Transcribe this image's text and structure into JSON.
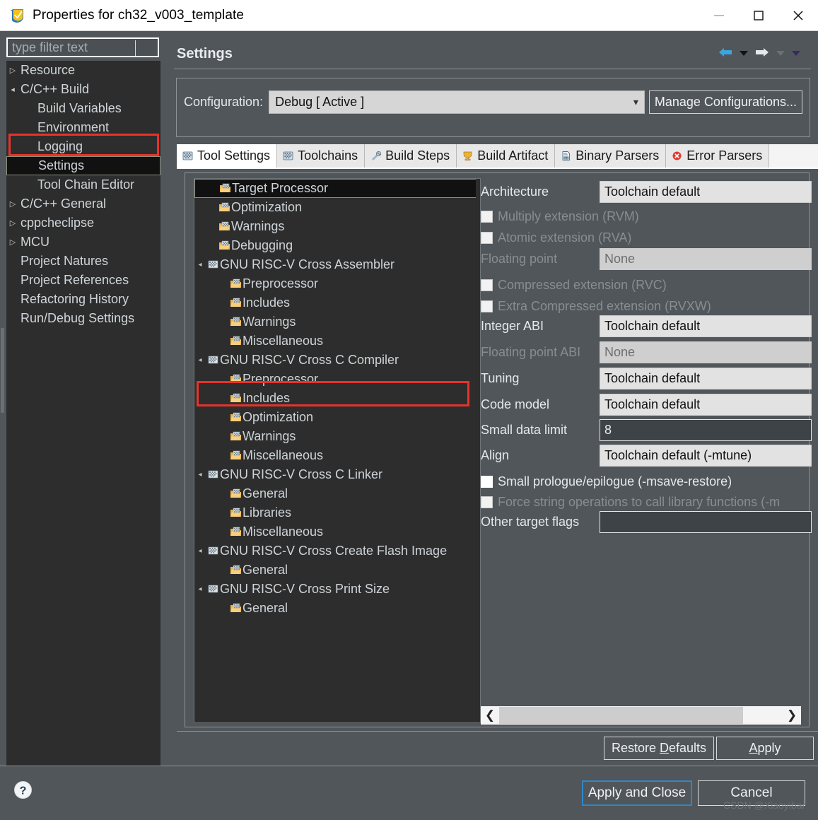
{
  "window": {
    "title": "Properties for ch32_v003_template",
    "app_icon": "eclipse-properties-icon",
    "minimize": "minimize-icon",
    "maximize": "maximize-icon",
    "close": "close-icon"
  },
  "filter": {
    "placeholder": "type filter text",
    "value": ""
  },
  "sidebar": {
    "items": [
      {
        "label": "Resource",
        "arrow": "▷",
        "indent": 0,
        "selected": false
      },
      {
        "label": "C/C++ Build",
        "arrow": "◂",
        "indent": 0,
        "selected": false
      },
      {
        "label": "Build Variables",
        "arrow": "",
        "indent": 1,
        "selected": false
      },
      {
        "label": "Environment",
        "arrow": "",
        "indent": 1,
        "selected": false
      },
      {
        "label": "Logging",
        "arrow": "",
        "indent": 1,
        "selected": false
      },
      {
        "label": "Settings",
        "arrow": "",
        "indent": 1,
        "selected": true
      },
      {
        "label": "Tool Chain Editor",
        "arrow": "",
        "indent": 1,
        "selected": false
      },
      {
        "label": "C/C++ General",
        "arrow": "▷",
        "indent": 0,
        "selected": false
      },
      {
        "label": "cppcheclipse",
        "arrow": "▷",
        "indent": 0,
        "selected": false
      },
      {
        "label": "MCU",
        "arrow": "▷",
        "indent": 0,
        "selected": false
      },
      {
        "label": "Project Natures",
        "arrow": "",
        "indent": 0,
        "selected": false
      },
      {
        "label": "Project References",
        "arrow": "",
        "indent": 0,
        "selected": false
      },
      {
        "label": "Refactoring History",
        "arrow": "",
        "indent": 0,
        "selected": false
      },
      {
        "label": "Run/Debug Settings",
        "arrow": "",
        "indent": 0,
        "selected": false
      }
    ]
  },
  "header": {
    "title": "Settings",
    "back_icon": "back-arrow-icon",
    "back_dropdown_icon": "chevron-down-icon",
    "forward_icon": "forward-arrow-icon",
    "forward_dropdown_icon": "chevron-down-icon",
    "menu_dropdown_icon": "chevron-down-icon"
  },
  "configuration": {
    "label": "Configuration:",
    "value": "Debug  [ Active ]",
    "dropdown_icon": "chevron-down-icon",
    "manage_button": "Manage Configurations..."
  },
  "tabs": [
    {
      "label": "Tool Settings",
      "icon": "tool-settings-icon",
      "active": true
    },
    {
      "label": "Toolchains",
      "icon": "toolchains-icon",
      "active": false
    },
    {
      "label": "Build Steps",
      "icon": "build-steps-icon",
      "active": false
    },
    {
      "label": "Build Artifact",
      "icon": "build-artifact-icon",
      "active": false
    },
    {
      "label": "Binary Parsers",
      "icon": "binary-parsers-icon",
      "active": false
    },
    {
      "label": "Error Parsers",
      "icon": "error-parsers-icon",
      "active": false
    }
  ],
  "tool_tree": [
    {
      "label": "Target Processor",
      "indent": 1,
      "arrow": "",
      "icon": "folder-icon",
      "selected": true
    },
    {
      "label": "Optimization",
      "indent": 1,
      "arrow": "",
      "icon": "folder-icon",
      "selected": false
    },
    {
      "label": "Warnings",
      "indent": 1,
      "arrow": "",
      "icon": "folder-icon",
      "selected": false
    },
    {
      "label": "Debugging",
      "indent": 1,
      "arrow": "",
      "icon": "folder-icon",
      "selected": false
    },
    {
      "label": "GNU RISC-V Cross Assembler",
      "indent": 0,
      "arrow": "◂",
      "icon": "tool-icon",
      "selected": false
    },
    {
      "label": "Preprocessor",
      "indent": 2,
      "arrow": "",
      "icon": "folder-icon",
      "selected": false
    },
    {
      "label": "Includes",
      "indent": 2,
      "arrow": "",
      "icon": "folder-icon",
      "selected": false
    },
    {
      "label": "Warnings",
      "indent": 2,
      "arrow": "",
      "icon": "folder-icon",
      "selected": false
    },
    {
      "label": "Miscellaneous",
      "indent": 2,
      "arrow": "",
      "icon": "folder-icon",
      "selected": false
    },
    {
      "label": "GNU RISC-V Cross C Compiler",
      "indent": 0,
      "arrow": "◂",
      "icon": "tool-icon",
      "selected": false
    },
    {
      "label": "Preprocessor",
      "indent": 2,
      "arrow": "",
      "icon": "folder-icon",
      "selected": false
    },
    {
      "label": "Includes",
      "indent": 2,
      "arrow": "",
      "icon": "folder-icon",
      "selected": false
    },
    {
      "label": "Optimization",
      "indent": 2,
      "arrow": "",
      "icon": "folder-icon",
      "selected": false
    },
    {
      "label": "Warnings",
      "indent": 2,
      "arrow": "",
      "icon": "folder-icon",
      "selected": false
    },
    {
      "label": "Miscellaneous",
      "indent": 2,
      "arrow": "",
      "icon": "folder-icon",
      "selected": false
    },
    {
      "label": "GNU RISC-V Cross C Linker",
      "indent": 0,
      "arrow": "◂",
      "icon": "tool-icon",
      "selected": false
    },
    {
      "label": "General",
      "indent": 2,
      "arrow": "",
      "icon": "folder-icon",
      "selected": false
    },
    {
      "label": "Libraries",
      "indent": 2,
      "arrow": "",
      "icon": "folder-icon",
      "selected": false
    },
    {
      "label": "Miscellaneous",
      "indent": 2,
      "arrow": "",
      "icon": "folder-icon",
      "selected": false
    },
    {
      "label": "GNU RISC-V Cross Create Flash Image",
      "indent": 0,
      "arrow": "◂",
      "icon": "tool-icon",
      "selected": false
    },
    {
      "label": "General",
      "indent": 2,
      "arrow": "",
      "icon": "folder-icon",
      "selected": false
    },
    {
      "label": "GNU RISC-V Cross Print Size",
      "indent": 0,
      "arrow": "◂",
      "icon": "tool-icon",
      "selected": false
    },
    {
      "label": "General",
      "indent": 2,
      "arrow": "",
      "icon": "folder-icon",
      "selected": false
    }
  ],
  "fields": [
    {
      "kind": "combo",
      "label": "Architecture",
      "value": "Toolchain default",
      "disabled": false
    },
    {
      "kind": "checkbox",
      "label": "Multiply extension (RVM)",
      "checked": false,
      "disabled": true
    },
    {
      "kind": "checkbox",
      "label": "Atomic extension (RVA)",
      "checked": false,
      "disabled": true
    },
    {
      "kind": "combo",
      "label": "Floating point",
      "value": "None",
      "disabled": true
    },
    {
      "kind": "checkbox",
      "label": "Compressed extension (RVC)",
      "checked": false,
      "disabled": true
    },
    {
      "kind": "checkbox",
      "label": "Extra Compressed extension (RVXW)",
      "checked": false,
      "disabled": true
    },
    {
      "kind": "combo",
      "label": "Integer ABI",
      "value": "Toolchain default",
      "disabled": false
    },
    {
      "kind": "combo",
      "label": "Floating point ABI",
      "value": "None",
      "disabled": true
    },
    {
      "kind": "combo",
      "label": "Tuning",
      "value": "Toolchain default",
      "disabled": false
    },
    {
      "kind": "combo",
      "label": "Code model",
      "value": "Toolchain default",
      "disabled": false
    },
    {
      "kind": "text",
      "label": "Small data limit",
      "value": "8",
      "disabled": false
    },
    {
      "kind": "combo",
      "label": "Align",
      "value": "Toolchain default (-mtune)",
      "disabled": false
    },
    {
      "kind": "checkbox",
      "label": "Small prologue/epilogue (-msave-restore)",
      "checked": false,
      "disabled": false
    },
    {
      "kind": "checkbox",
      "label": "Force string operations to call library functions (-m",
      "checked": false,
      "disabled": true
    },
    {
      "kind": "text",
      "label": "Other target flags",
      "value": "",
      "disabled": false
    }
  ],
  "hscroll": {
    "left_arrow": "chevron-left-icon",
    "right_arrow": "chevron-right-icon"
  },
  "buttons": {
    "restore_defaults": "Restore Defaults",
    "restore_defaults_mnemonic": "D",
    "apply": "Apply",
    "apply_mnemonic": "A",
    "apply_and_close": "Apply and Close",
    "cancel": "Cancel",
    "help_icon": "help-icon"
  },
  "watermark": "CSDN @Xiaoyibar",
  "colors": {
    "background": "#50565a",
    "tree_background": "#2d2d2d",
    "highlight_red": "#e8332a",
    "accent_blue": "#2f87c8",
    "field_light": "#e2e2e2",
    "text_primary": "#e5e9ec",
    "text_disabled": "#878d91"
  }
}
